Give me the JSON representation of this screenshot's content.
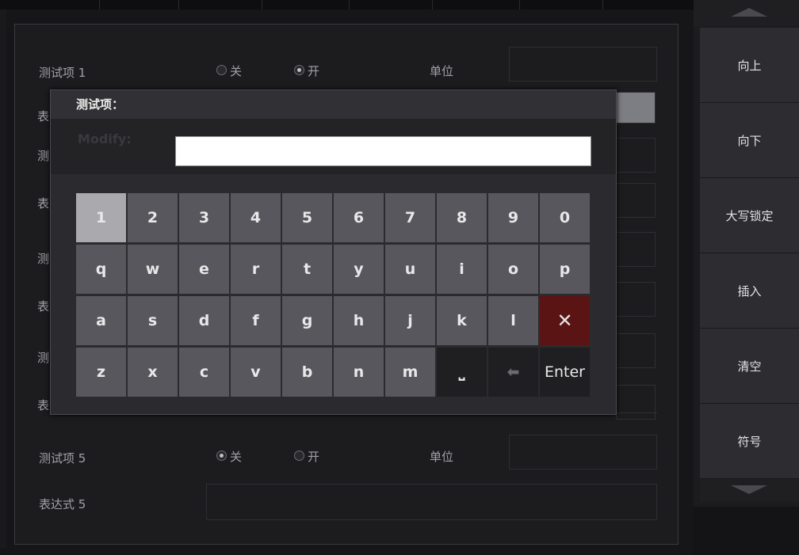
{
  "form": {
    "rows": [
      {
        "item_label": "测试项 1",
        "radio_off": "关",
        "radio_on": "开",
        "unit_label": "单位",
        "selected": "on"
      },
      {
        "item_label": "测试项 5",
        "radio_off": "关",
        "radio_on": "开",
        "unit_label": "单位",
        "selected": "off"
      }
    ],
    "expr_label_5": "表达式 5",
    "partial_labels": [
      "表",
      "测",
      "表",
      "测",
      "表",
      "测",
      "表"
    ]
  },
  "keyboard": {
    "title": "测试项：",
    "modify_label": "Modify:",
    "input_value": "",
    "rows": [
      [
        "1",
        "2",
        "3",
        "4",
        "5",
        "6",
        "7",
        "8",
        "9",
        "0"
      ],
      [
        "q",
        "w",
        "e",
        "r",
        "t",
        "y",
        "u",
        "i",
        "o",
        "p"
      ],
      [
        "a",
        "s",
        "d",
        "f",
        "g",
        "h",
        "j",
        "k",
        "l",
        "✕"
      ],
      [
        "z",
        "x",
        "c",
        "v",
        "b",
        "n",
        "m",
        "⎵",
        "⬅",
        "Enter"
      ]
    ]
  },
  "sidebar": {
    "buttons": [
      "向上",
      "向下",
      "大写锁定",
      "插入",
      "清空",
      "符号"
    ],
    "up_arrow": "triangle-up-icon",
    "down_arrow": "triangle-down-icon"
  }
}
